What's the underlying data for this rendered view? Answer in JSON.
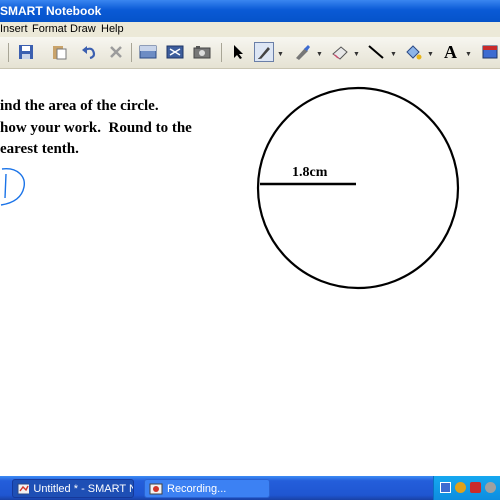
{
  "window": {
    "title": "SMART Notebook"
  },
  "menu": [
    "Insert",
    "Format",
    "Draw",
    "Help"
  ],
  "toolbar": {
    "icons": [
      "save-icon",
      "paste-icon",
      "undo-icon",
      "delete-icon",
      "screen-shade-icon",
      "full-screen-icon",
      "camera-icon",
      "select-arrow-icon",
      "pen-icon",
      "highlighter-icon",
      "eraser-icon",
      "line-icon",
      "fill-icon",
      "text-icon",
      "shapes-icon"
    ]
  },
  "canvas": {
    "problem_lines": [
      "ind the area of the circle.",
      "how your work.  Round to the",
      "earest tenth."
    ],
    "radius_label": "1.8cm",
    "ink_color": "#1a73e8"
  },
  "taskbar": {
    "buttons": [
      {
        "label": "Untitled * - SMART N...",
        "active": true
      },
      {
        "label": "Recording...",
        "active": false
      }
    ],
    "tray_icons": [
      "network-icon",
      "volume-icon",
      "shield-icon",
      "clock-icon"
    ]
  }
}
